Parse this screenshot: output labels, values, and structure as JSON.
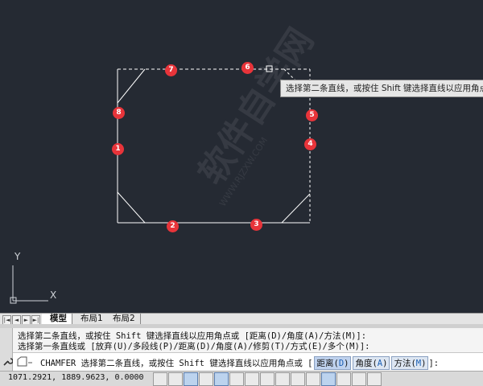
{
  "canvas": {
    "markers": [
      "1",
      "2",
      "3",
      "4",
      "5",
      "6",
      "7",
      "8"
    ],
    "tooltip": "选择第二条直线，或按住 Shift 键选择直线以应用角点或",
    "ucs": {
      "x_label": "X",
      "y_label": "Y"
    },
    "watermark": "软件自学网",
    "watermark_url": "WWW.RJZXW.COM"
  },
  "tabs": {
    "items": [
      "模型",
      "布局1",
      "布局2"
    ],
    "active": "模型",
    "nav": [
      "|◄",
      "◄",
      "►",
      "►|"
    ]
  },
  "command": {
    "history_line_1": "选择第二条直线，或按住 Shift 键选择直线以应用角点或 [距离(D)/角度(A)/方法(M)]:",
    "history_line_2": "选择第一条直线或 [放弃(U)/多段线(P)/距离(D)/角度(A)/修剪(T)/方式(E)/多个(M)]:",
    "prompt_prefix": "CHAMFER 选择第二条直线，或按住 Shift 键选择直线以应用角点或",
    "options": [
      {
        "label": "距离",
        "key": "D"
      },
      {
        "label": "角度",
        "key": "A"
      },
      {
        "label": "方法",
        "key": "M"
      }
    ],
    "suffix": "]:",
    "bracket_open": "["
  },
  "status": {
    "coordinates": "1071.2921, 1889.9623, 0.0000"
  },
  "colors": {
    "background": "#252a33",
    "marker": "#e8343a",
    "geometry": "#ffffff"
  }
}
